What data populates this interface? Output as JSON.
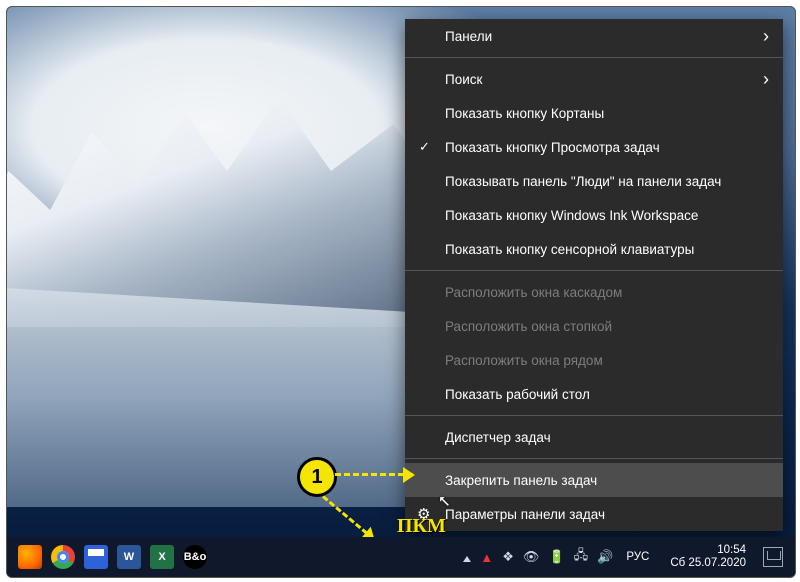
{
  "menu": {
    "items": [
      {
        "label": "Панели",
        "type": "sub"
      },
      {
        "type": "sep"
      },
      {
        "label": "Поиск",
        "type": "sub"
      },
      {
        "label": "Показать кнопку Кортаны"
      },
      {
        "label": "Показать кнопку Просмотра задач",
        "type": "check"
      },
      {
        "label": "Показывать панель \"Люди\" на панели задач"
      },
      {
        "label": "Показать кнопку Windows Ink Workspace"
      },
      {
        "label": "Показать кнопку сенсорной клавиатуры"
      },
      {
        "type": "sep"
      },
      {
        "label": "Расположить окна каскадом",
        "disabled": true
      },
      {
        "label": "Расположить окна стопкой",
        "disabled": true
      },
      {
        "label": "Расположить окна рядом",
        "disabled": true
      },
      {
        "label": "Показать рабочий стол"
      },
      {
        "type": "sep"
      },
      {
        "label": "Диспетчер задач"
      },
      {
        "type": "sep"
      },
      {
        "label": "Закрепить панель задач",
        "hover": true
      },
      {
        "label": "Параметры панели задач",
        "type": "gear"
      }
    ]
  },
  "annotation": {
    "badge": "1",
    "label": "ПКМ"
  },
  "taskbar": {
    "apps": [
      {
        "name": "firefox",
        "glyph": ""
      },
      {
        "name": "chrome",
        "glyph": ""
      },
      {
        "name": "save",
        "glyph": ""
      },
      {
        "name": "word",
        "glyph": "W"
      },
      {
        "name": "excel",
        "glyph": "X"
      },
      {
        "name": "bang-olufsen",
        "glyph": "B&o"
      }
    ],
    "lang": "РУС",
    "time": "10:54",
    "date": "Сб 25.07.2020"
  }
}
